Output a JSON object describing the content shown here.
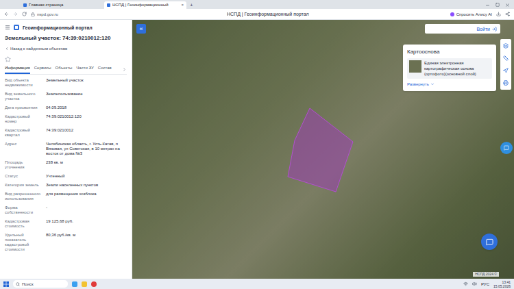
{
  "browser": {
    "tabs": [
      {
        "label": "Главная страница",
        "selected": false
      },
      {
        "label": "НСПД | Геоинформационный",
        "selected": true
      }
    ],
    "tab_close": "×",
    "new_tab": "+",
    "address": "nspd.gov.ru",
    "page_title": "НСПД | Геоинформационный портал",
    "alice": "Спросить Алису AI"
  },
  "portal": {
    "title": "Геоинформационный портал",
    "object_title": "Земельный участок: 74:39:0210012:120",
    "back": "Назад к найденным объектам",
    "favorite": false,
    "tabs": [
      {
        "label": "Информация",
        "selected": true
      },
      {
        "label": "Сервисы",
        "selected": false
      },
      {
        "label": "Объекты",
        "selected": false
      },
      {
        "label": "Части ЗУ",
        "selected": false
      },
      {
        "label": "Состав",
        "selected": false
      }
    ],
    "fields": [
      {
        "label": "Вид объекта недвижимости",
        "value": "Земельный участок"
      },
      {
        "label": "Вид земельного участка",
        "value": "Землепользование"
      },
      {
        "label": "Дата присвоения",
        "value": "04.09.2018"
      },
      {
        "label": "Кадастровый номер",
        "value": "74:39:0210012:120"
      },
      {
        "label": "Кадастровый квартал",
        "value": "74:39:0210012"
      },
      {
        "label": "Адрес",
        "value": "Челябинская область, г. Усть-Катав, п Вязовая, ул Советская, в 10 метрах на восток от дома №3"
      },
      {
        "label": "Площадь уточнения",
        "value": "238 кв. м"
      },
      {
        "label": "Статус",
        "value": "Учтенный"
      },
      {
        "label": "Категория земель",
        "value": "Земли населенных пунктов"
      },
      {
        "label": "Вид разрешенного использования",
        "value": "для размещения хозблока"
      },
      {
        "label": "Форма собственности",
        "value": "-"
      },
      {
        "label": "Кадастровая стоимость",
        "value": "19 125,68 руб."
      },
      {
        "label": "Удельный показатель кадастровой стоимости",
        "value": "80,36 руб./кв. м"
      }
    ]
  },
  "map": {
    "collapse": "«",
    "login": "Войти",
    "layers_panel": {
      "title": "Картооснова",
      "layer": "Единая электронная картографическая основа (ортофото)(основной слой)",
      "expand": "Развернуть"
    },
    "attribution": "НСПД 2024 ©"
  },
  "taskbar": {
    "search": "Поиск",
    "lang": "РУС",
    "time": "13:41",
    "date": "15.05.2026"
  }
}
